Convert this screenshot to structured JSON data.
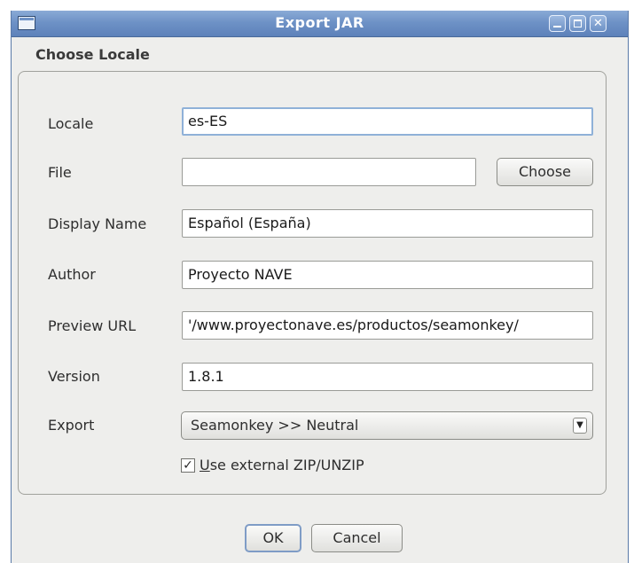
{
  "window": {
    "title": "Export JAR",
    "close_glyph": "✕"
  },
  "group": {
    "title": "Choose Locale"
  },
  "fields": {
    "locale": {
      "label": "Locale",
      "value": "es-ES"
    },
    "file": {
      "label": "File",
      "value": "",
      "button": "Choose"
    },
    "display_name": {
      "label": "Display Name",
      "value": "Español (España)"
    },
    "author": {
      "label": "Author",
      "value": "Proyecto NAVE"
    },
    "preview_url": {
      "label": "Preview URL",
      "value": "'/www.proyectonave.es/productos/seamonkey/"
    },
    "version": {
      "label": "Version",
      "value": "1.8.1"
    },
    "export": {
      "label": "Export",
      "selected": "Seamonkey >> Neutral",
      "arrow_glyph": "▼"
    }
  },
  "options": {
    "use_external_zip": {
      "checked": true,
      "glyph": "✓",
      "mnemonic": "U",
      "rest": "se external ZIP/UNZIP"
    }
  },
  "buttons": {
    "ok": "OK",
    "cancel": "Cancel"
  },
  "icons": [
    "window-menu-icon",
    "minimize-icon",
    "maximize-icon",
    "close-icon",
    "dropdown-arrow-icon",
    "checkmark-icon"
  ]
}
